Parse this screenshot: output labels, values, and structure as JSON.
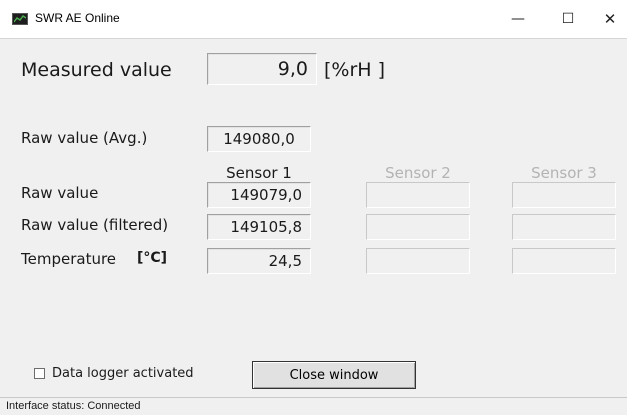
{
  "window": {
    "title": "SWR AE Online",
    "minimize_glyph": "—",
    "maximize_glyph": "☐",
    "close_glyph": "✕"
  },
  "measured": {
    "label": "Measured value",
    "value": "9,0",
    "unit": "[%rH   ]"
  },
  "raw_avg": {
    "label": "Raw value (Avg.)",
    "value": "149080,0"
  },
  "sensors": {
    "headers": [
      "Sensor 1",
      "Sensor 2",
      "Sensor 3"
    ],
    "rows": [
      {
        "label": "Raw value",
        "unit": "",
        "values": [
          "149079,0",
          "",
          ""
        ]
      },
      {
        "label": "Raw value (filtered)",
        "unit": "",
        "values": [
          "149105,8",
          "",
          ""
        ]
      },
      {
        "label": "Temperature",
        "unit": "[°C]",
        "values": [
          "24,5",
          "",
          ""
        ]
      }
    ]
  },
  "logger": {
    "label": "Data logger activated",
    "checked": false
  },
  "close_button": {
    "label": "Close window"
  },
  "status": {
    "text": "Interface status: Connected"
  }
}
